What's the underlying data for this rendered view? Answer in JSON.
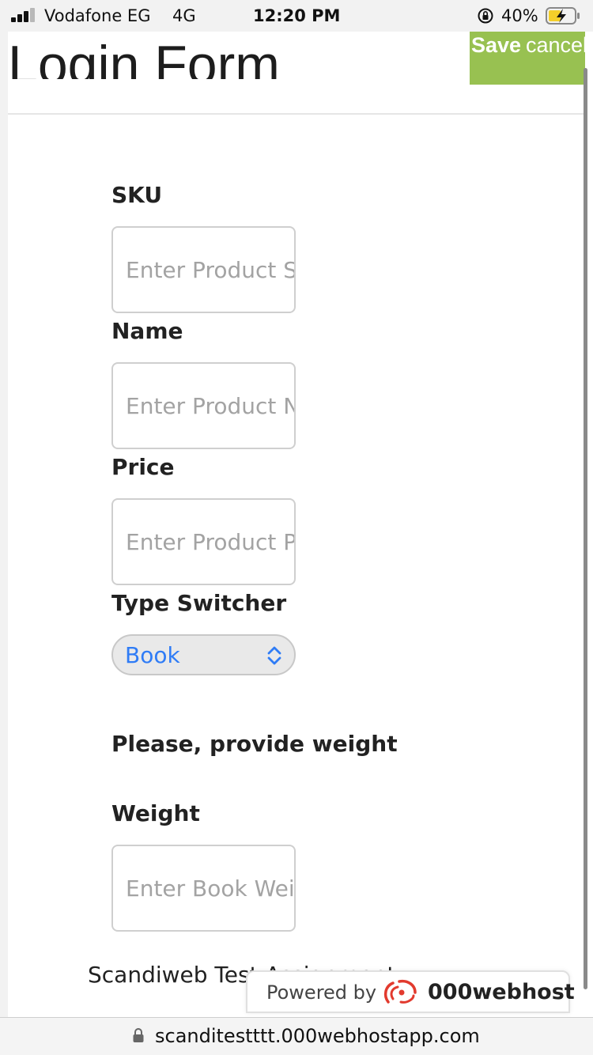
{
  "status_bar": {
    "carrier": "Vodafone EG",
    "network": "4G",
    "time": "12:20 PM",
    "battery_percent": "40%"
  },
  "header": {
    "title": "Login Form",
    "save_label": "Save",
    "cancel_label": "cancel",
    "accent_color": "#98c151"
  },
  "form": {
    "sku": {
      "label": "SKU",
      "placeholder": "Enter Product SKU"
    },
    "name": {
      "label": "Name",
      "placeholder": "Enter Product Name"
    },
    "price": {
      "label": "Price",
      "placeholder": "Enter Product Price"
    },
    "type_switcher": {
      "label": "Type Switcher",
      "selected": "Book"
    },
    "hint": "Please, provide weight",
    "weight": {
      "label": "Weight",
      "placeholder": "Enter Book Weight"
    }
  },
  "footer": {
    "text": "Scandiweb Test Assignment"
  },
  "hosting_badge": {
    "powered_by": "Powered by",
    "brand": "000webhost"
  },
  "browser": {
    "url": "scanditestttt.000webhostapp.com"
  }
}
